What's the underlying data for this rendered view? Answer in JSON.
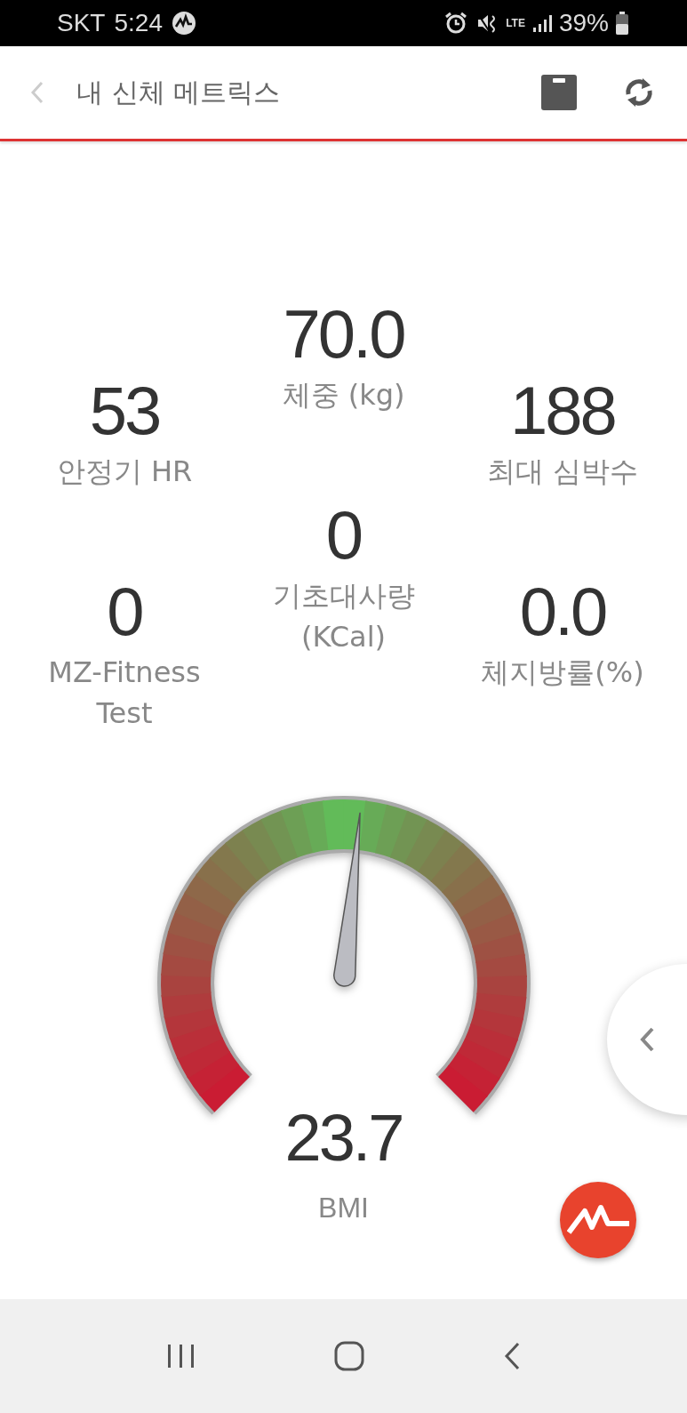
{
  "status_bar": {
    "carrier": "SKT",
    "time": "5:24",
    "network": "LTE",
    "battery": "39%"
  },
  "header": {
    "title": "내 신체 메트릭스"
  },
  "metric_columns": [
    {
      "metrics": [
        {
          "value": "53",
          "label": "안정기 HR"
        },
        {
          "value": "0",
          "label": "MZ-Fitness Test"
        }
      ]
    },
    {
      "metrics": [
        {
          "value": "70.0",
          "label": "체중 (kg)"
        },
        {
          "value": "0",
          "label": "기초대사량 (KCal)"
        }
      ]
    },
    {
      "metrics": [
        {
          "value": "188",
          "label": "최대 심박수"
        },
        {
          "value": "0.0",
          "label": "체지방률(%)"
        }
      ]
    }
  ],
  "gauge": {
    "level": 0.52,
    "value": "23.7",
    "label": "BMI"
  }
}
